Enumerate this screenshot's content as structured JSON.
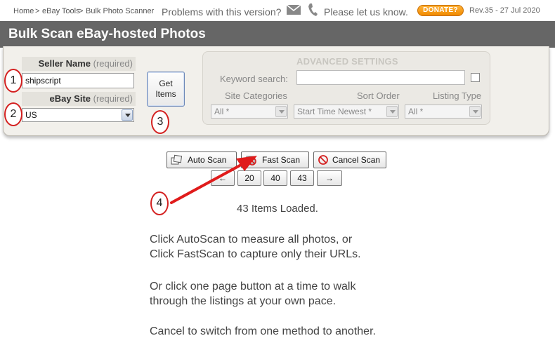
{
  "header": {
    "breadcrumb": [
      "Home",
      "eBay Tools",
      "Bulk Photo Scanner"
    ],
    "breadcrumb_sep": ">",
    "problems_text": "Problems with this version?",
    "please_text": "Please let us know.",
    "donate_label": "DONATE?",
    "revision": "Rev.35 - 27 Jul 2020"
  },
  "title": "Bulk Scan eBay-hosted Photos",
  "form": {
    "seller_label": "Seller Name",
    "seller_required": "(required)",
    "seller_value": "shipscript",
    "site_label": "eBay Site",
    "site_required": "(required)",
    "site_value": "US",
    "get_items_label": [
      "Get",
      "Items"
    ]
  },
  "advanced": {
    "title": "ADVANCED SETTINGS",
    "keyword_label": "Keyword search:",
    "keyword_value": "",
    "site_categories_label": "Site Categories",
    "sort_order_label": "Sort Order",
    "listing_type_label": "Listing Type",
    "site_categories_value": "All *",
    "sort_order_value": "Start Time Newest *",
    "listing_type_value": "All *"
  },
  "scan": {
    "auto_label": "Auto Scan",
    "fast_label": "Fast Scan",
    "cancel_label": "Cancel Scan"
  },
  "pages": {
    "prev": "←",
    "buttons": [
      "20",
      "40",
      "43"
    ],
    "next": "→"
  },
  "annotations": [
    "1",
    "2",
    "3",
    "4"
  ],
  "status": "43 Items Loaded.",
  "instructions": [
    [
      "Click AutoScan to measure all photos, or",
      "Click FastScan to capture only their URLs."
    ],
    [
      "Or click one page button at a time to walk",
      "through the listings at your own pace."
    ],
    [
      "Cancel to switch from one method to another."
    ]
  ],
  "colors": {
    "title_bar": "#666666",
    "annotation_red": "#d42020",
    "donate_orange": "#f5a623"
  }
}
